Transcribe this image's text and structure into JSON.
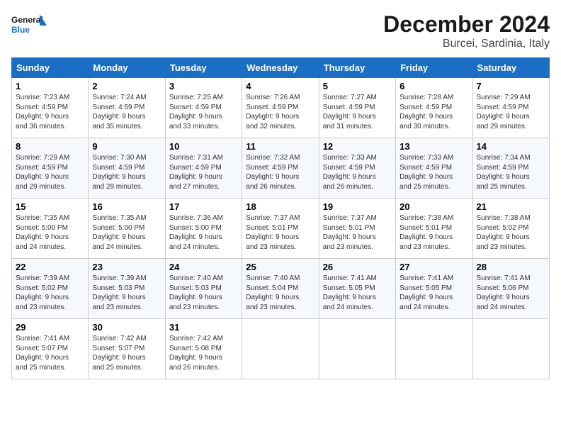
{
  "logo": {
    "line1": "General",
    "line2": "Blue"
  },
  "title": "December 2024",
  "location": "Burcei, Sardinia, Italy",
  "days_of_week": [
    "Sunday",
    "Monday",
    "Tuesday",
    "Wednesday",
    "Thursday",
    "Friday",
    "Saturday"
  ],
  "weeks": [
    [
      {
        "day": "1",
        "info": "Sunrise: 7:23 AM\nSunset: 4:59 PM\nDaylight: 9 hours\nand 36 minutes."
      },
      {
        "day": "2",
        "info": "Sunrise: 7:24 AM\nSunset: 4:59 PM\nDaylight: 9 hours\nand 35 minutes."
      },
      {
        "day": "3",
        "info": "Sunrise: 7:25 AM\nSunset: 4:59 PM\nDaylight: 9 hours\nand 33 minutes."
      },
      {
        "day": "4",
        "info": "Sunrise: 7:26 AM\nSunset: 4:59 PM\nDaylight: 9 hours\nand 32 minutes."
      },
      {
        "day": "5",
        "info": "Sunrise: 7:27 AM\nSunset: 4:59 PM\nDaylight: 9 hours\nand 31 minutes."
      },
      {
        "day": "6",
        "info": "Sunrise: 7:28 AM\nSunset: 4:59 PM\nDaylight: 9 hours\nand 30 minutes."
      },
      {
        "day": "7",
        "info": "Sunrise: 7:29 AM\nSunset: 4:59 PM\nDaylight: 9 hours\nand 29 minutes."
      }
    ],
    [
      {
        "day": "8",
        "info": "Sunrise: 7:29 AM\nSunset: 4:59 PM\nDaylight: 9 hours\nand 29 minutes."
      },
      {
        "day": "9",
        "info": "Sunrise: 7:30 AM\nSunset: 4:59 PM\nDaylight: 9 hours\nand 28 minutes."
      },
      {
        "day": "10",
        "info": "Sunrise: 7:31 AM\nSunset: 4:59 PM\nDaylight: 9 hours\nand 27 minutes."
      },
      {
        "day": "11",
        "info": "Sunrise: 7:32 AM\nSunset: 4:59 PM\nDaylight: 9 hours\nand 26 minutes."
      },
      {
        "day": "12",
        "info": "Sunrise: 7:33 AM\nSunset: 4:59 PM\nDaylight: 9 hours\nand 26 minutes."
      },
      {
        "day": "13",
        "info": "Sunrise: 7:33 AM\nSunset: 4:59 PM\nDaylight: 9 hours\nand 25 minutes."
      },
      {
        "day": "14",
        "info": "Sunrise: 7:34 AM\nSunset: 4:59 PM\nDaylight: 9 hours\nand 25 minutes."
      }
    ],
    [
      {
        "day": "15",
        "info": "Sunrise: 7:35 AM\nSunset: 5:00 PM\nDaylight: 9 hours\nand 24 minutes."
      },
      {
        "day": "16",
        "info": "Sunrise: 7:35 AM\nSunset: 5:00 PM\nDaylight: 9 hours\nand 24 minutes."
      },
      {
        "day": "17",
        "info": "Sunrise: 7:36 AM\nSunset: 5:00 PM\nDaylight: 9 hours\nand 24 minutes."
      },
      {
        "day": "18",
        "info": "Sunrise: 7:37 AM\nSunset: 5:01 PM\nDaylight: 9 hours\nand 23 minutes."
      },
      {
        "day": "19",
        "info": "Sunrise: 7:37 AM\nSunset: 5:01 PM\nDaylight: 9 hours\nand 23 minutes."
      },
      {
        "day": "20",
        "info": "Sunrise: 7:38 AM\nSunset: 5:01 PM\nDaylight: 9 hours\nand 23 minutes."
      },
      {
        "day": "21",
        "info": "Sunrise: 7:38 AM\nSunset: 5:02 PM\nDaylight: 9 hours\nand 23 minutes."
      }
    ],
    [
      {
        "day": "22",
        "info": "Sunrise: 7:39 AM\nSunset: 5:02 PM\nDaylight: 9 hours\nand 23 minutes."
      },
      {
        "day": "23",
        "info": "Sunrise: 7:39 AM\nSunset: 5:03 PM\nDaylight: 9 hours\nand 23 minutes."
      },
      {
        "day": "24",
        "info": "Sunrise: 7:40 AM\nSunset: 5:03 PM\nDaylight: 9 hours\nand 23 minutes."
      },
      {
        "day": "25",
        "info": "Sunrise: 7:40 AM\nSunset: 5:04 PM\nDaylight: 9 hours\nand 23 minutes."
      },
      {
        "day": "26",
        "info": "Sunrise: 7:41 AM\nSunset: 5:05 PM\nDaylight: 9 hours\nand 24 minutes."
      },
      {
        "day": "27",
        "info": "Sunrise: 7:41 AM\nSunset: 5:05 PM\nDaylight: 9 hours\nand 24 minutes."
      },
      {
        "day": "28",
        "info": "Sunrise: 7:41 AM\nSunset: 5:06 PM\nDaylight: 9 hours\nand 24 minutes."
      }
    ],
    [
      {
        "day": "29",
        "info": "Sunrise: 7:41 AM\nSunset: 5:07 PM\nDaylight: 9 hours\nand 25 minutes."
      },
      {
        "day": "30",
        "info": "Sunrise: 7:42 AM\nSunset: 5:07 PM\nDaylight: 9 hours\nand 25 minutes."
      },
      {
        "day": "31",
        "info": "Sunrise: 7:42 AM\nSunset: 5:08 PM\nDaylight: 9 hours\nand 26 minutes."
      },
      null,
      null,
      null,
      null
    ]
  ]
}
